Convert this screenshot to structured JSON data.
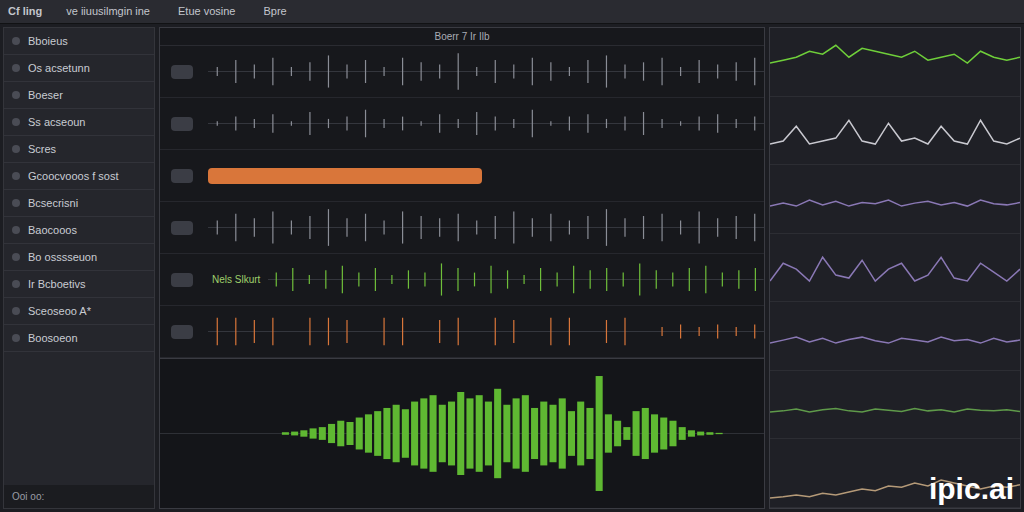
{
  "window": {
    "title": "Cf ling"
  },
  "menu": [
    {
      "label": "ve iiuusilmgin ine"
    },
    {
      "label": "Etue vosine"
    },
    {
      "label": "Bpre"
    }
  ],
  "sidebar": {
    "items": [
      {
        "label": "Bboieus"
      },
      {
        "label": "Os acsetunn"
      },
      {
        "label": "Boeser"
      },
      {
        "label": "Ss acseoun"
      },
      {
        "label": "Scres"
      },
      {
        "label": "Gcoocvooos f sost"
      },
      {
        "label": "Bcsecrisni"
      },
      {
        "label": "Baocooos"
      },
      {
        "label": "Bo osssseuon"
      },
      {
        "label": "Ir Bcboetivs"
      },
      {
        "label": "Sceoseoo A*"
      },
      {
        "label": "Boosoeon"
      }
    ]
  },
  "main": {
    "header": "Boerr 7 Ir Ilb"
  },
  "tracks": [
    {
      "kind": "spikes",
      "color": "#8a8d96",
      "values": [
        0.2,
        0.5,
        0.3,
        0.6,
        0.2,
        0.4,
        0.7,
        0.3,
        0.5,
        0.2,
        0.6,
        0.4,
        0.3,
        0.8,
        0.2,
        0.5,
        0.3,
        0.6,
        0.4,
        0.2,
        0.5,
        0.7,
        0.3,
        0.4,
        0.6,
        0.2,
        0.5,
        0.3,
        0.4,
        0.6
      ]
    },
    {
      "kind": "spikes",
      "color": "#8a8d96",
      "values": [
        0.1,
        0.3,
        0.2,
        0.4,
        0.1,
        0.5,
        0.2,
        0.3,
        0.6,
        0.2,
        0.3,
        0.1,
        0.4,
        0.2,
        0.5,
        0.3,
        0.2,
        0.6,
        0.1,
        0.3,
        0.4,
        0.2,
        0.3,
        0.5,
        0.2,
        0.1,
        0.3,
        0.4,
        0.2,
        0.3
      ]
    },
    {
      "kind": "clip",
      "color": "#d9763a",
      "level": 0.5
    },
    {
      "kind": "spikes",
      "color": "#8a8d96",
      "values": [
        0.3,
        0.6,
        0.4,
        0.7,
        0.3,
        0.5,
        0.8,
        0.4,
        0.6,
        0.3,
        0.7,
        0.5,
        0.4,
        0.6,
        0.3,
        0.5,
        0.7,
        0.4,
        0.6,
        0.3,
        0.5,
        0.8,
        0.4,
        0.5,
        0.6,
        0.3,
        0.7,
        0.4,
        0.5,
        0.6
      ]
    },
    {
      "kind": "spikes",
      "color": "#6fbf3a",
      "label": "Nels Slkurt",
      "values": [
        0.3,
        0.5,
        0.2,
        0.4,
        0.6,
        0.3,
        0.5,
        0.2,
        0.4,
        0.3,
        0.7,
        0.5,
        0.3,
        0.6,
        0.4,
        0.2,
        0.5,
        0.3,
        0.6,
        0.4,
        0.5,
        0.3,
        0.7,
        0.4,
        0.3,
        0.5,
        0.6,
        0.3,
        0.4,
        0.5
      ]
    },
    {
      "kind": "spikes",
      "color": "#d9763a",
      "values": [
        0.6,
        0.6,
        0.5,
        0.6,
        0.0,
        0.6,
        0.6,
        0.5,
        0.0,
        0.6,
        0.6,
        0.0,
        0.5,
        0.6,
        0.0,
        0.6,
        0.5,
        0.0,
        0.6,
        0.6,
        0.0,
        0.5,
        0.6,
        0.0,
        0.2,
        0.3,
        0.2,
        0.3,
        0.2,
        0.3
      ]
    }
  ],
  "waveform": {
    "color": "#5fb832",
    "values": [
      0.02,
      0.03,
      0.05,
      0.08,
      0.1,
      0.15,
      0.2,
      0.18,
      0.25,
      0.3,
      0.35,
      0.4,
      0.45,
      0.38,
      0.5,
      0.55,
      0.6,
      0.45,
      0.5,
      0.65,
      0.55,
      0.6,
      0.5,
      0.7,
      0.45,
      0.55,
      0.6,
      0.4,
      0.5,
      0.45,
      0.55,
      0.35,
      0.5,
      0.4,
      0.9,
      0.3,
      0.2,
      0.1,
      0.35,
      0.4,
      0.3,
      0.25,
      0.2,
      0.1,
      0.05,
      0.03,
      0.02,
      0.01
    ]
  },
  "scopes": [
    {
      "color": "#6fcf3a",
      "values": [
        0.5,
        0.55,
        0.6,
        0.7,
        0.65,
        0.8,
        0.6,
        0.75,
        0.7,
        0.65,
        0.6,
        0.7,
        0.55,
        0.6,
        0.65,
        0.5,
        0.7,
        0.6,
        0.55,
        0.6
      ]
    },
    {
      "color": "#c9c9d0",
      "values": [
        0.3,
        0.35,
        0.6,
        0.3,
        0.35,
        0.4,
        0.7,
        0.35,
        0.3,
        0.65,
        0.35,
        0.4,
        0.3,
        0.6,
        0.35,
        0.3,
        0.7,
        0.35,
        0.3,
        0.4
      ]
    },
    {
      "color": "#8a78b5",
      "values": [
        0.4,
        0.45,
        0.4,
        0.5,
        0.42,
        0.48,
        0.4,
        0.46,
        0.44,
        0.5,
        0.4,
        0.45,
        0.48,
        0.42,
        0.46,
        0.4,
        0.5,
        0.44,
        0.42,
        0.46
      ]
    },
    {
      "color": "#8a78b5",
      "values": [
        0.3,
        0.6,
        0.5,
        0.3,
        0.7,
        0.4,
        0.35,
        0.65,
        0.3,
        0.5,
        0.6,
        0.3,
        0.4,
        0.7,
        0.35,
        0.3,
        0.6,
        0.45,
        0.3,
        0.5
      ]
    },
    {
      "color": "#8a78b5",
      "values": [
        0.4,
        0.45,
        0.5,
        0.42,
        0.48,
        0.4,
        0.46,
        0.5,
        0.44,
        0.4,
        0.48,
        0.45,
        0.42,
        0.5,
        0.44,
        0.46,
        0.4,
        0.48,
        0.42,
        0.45
      ]
    },
    {
      "color": "#5f9a4a",
      "values": [
        0.4,
        0.42,
        0.45,
        0.4,
        0.44,
        0.46,
        0.42,
        0.4,
        0.45,
        0.43,
        0.41,
        0.46,
        0.42,
        0.44,
        0.4,
        0.45,
        0.43,
        0.42,
        0.44,
        0.41
      ]
    },
    {
      "color": "#b59a78",
      "values": [
        0.1,
        0.12,
        0.15,
        0.12,
        0.18,
        0.15,
        0.2,
        0.25,
        0.22,
        0.3,
        0.28,
        0.35,
        0.3,
        0.4,
        0.35,
        0.3,
        0.25,
        0.3,
        0.28,
        0.32
      ]
    }
  ],
  "status_bar": "Ooi oo:",
  "watermark": "ipic.ai"
}
